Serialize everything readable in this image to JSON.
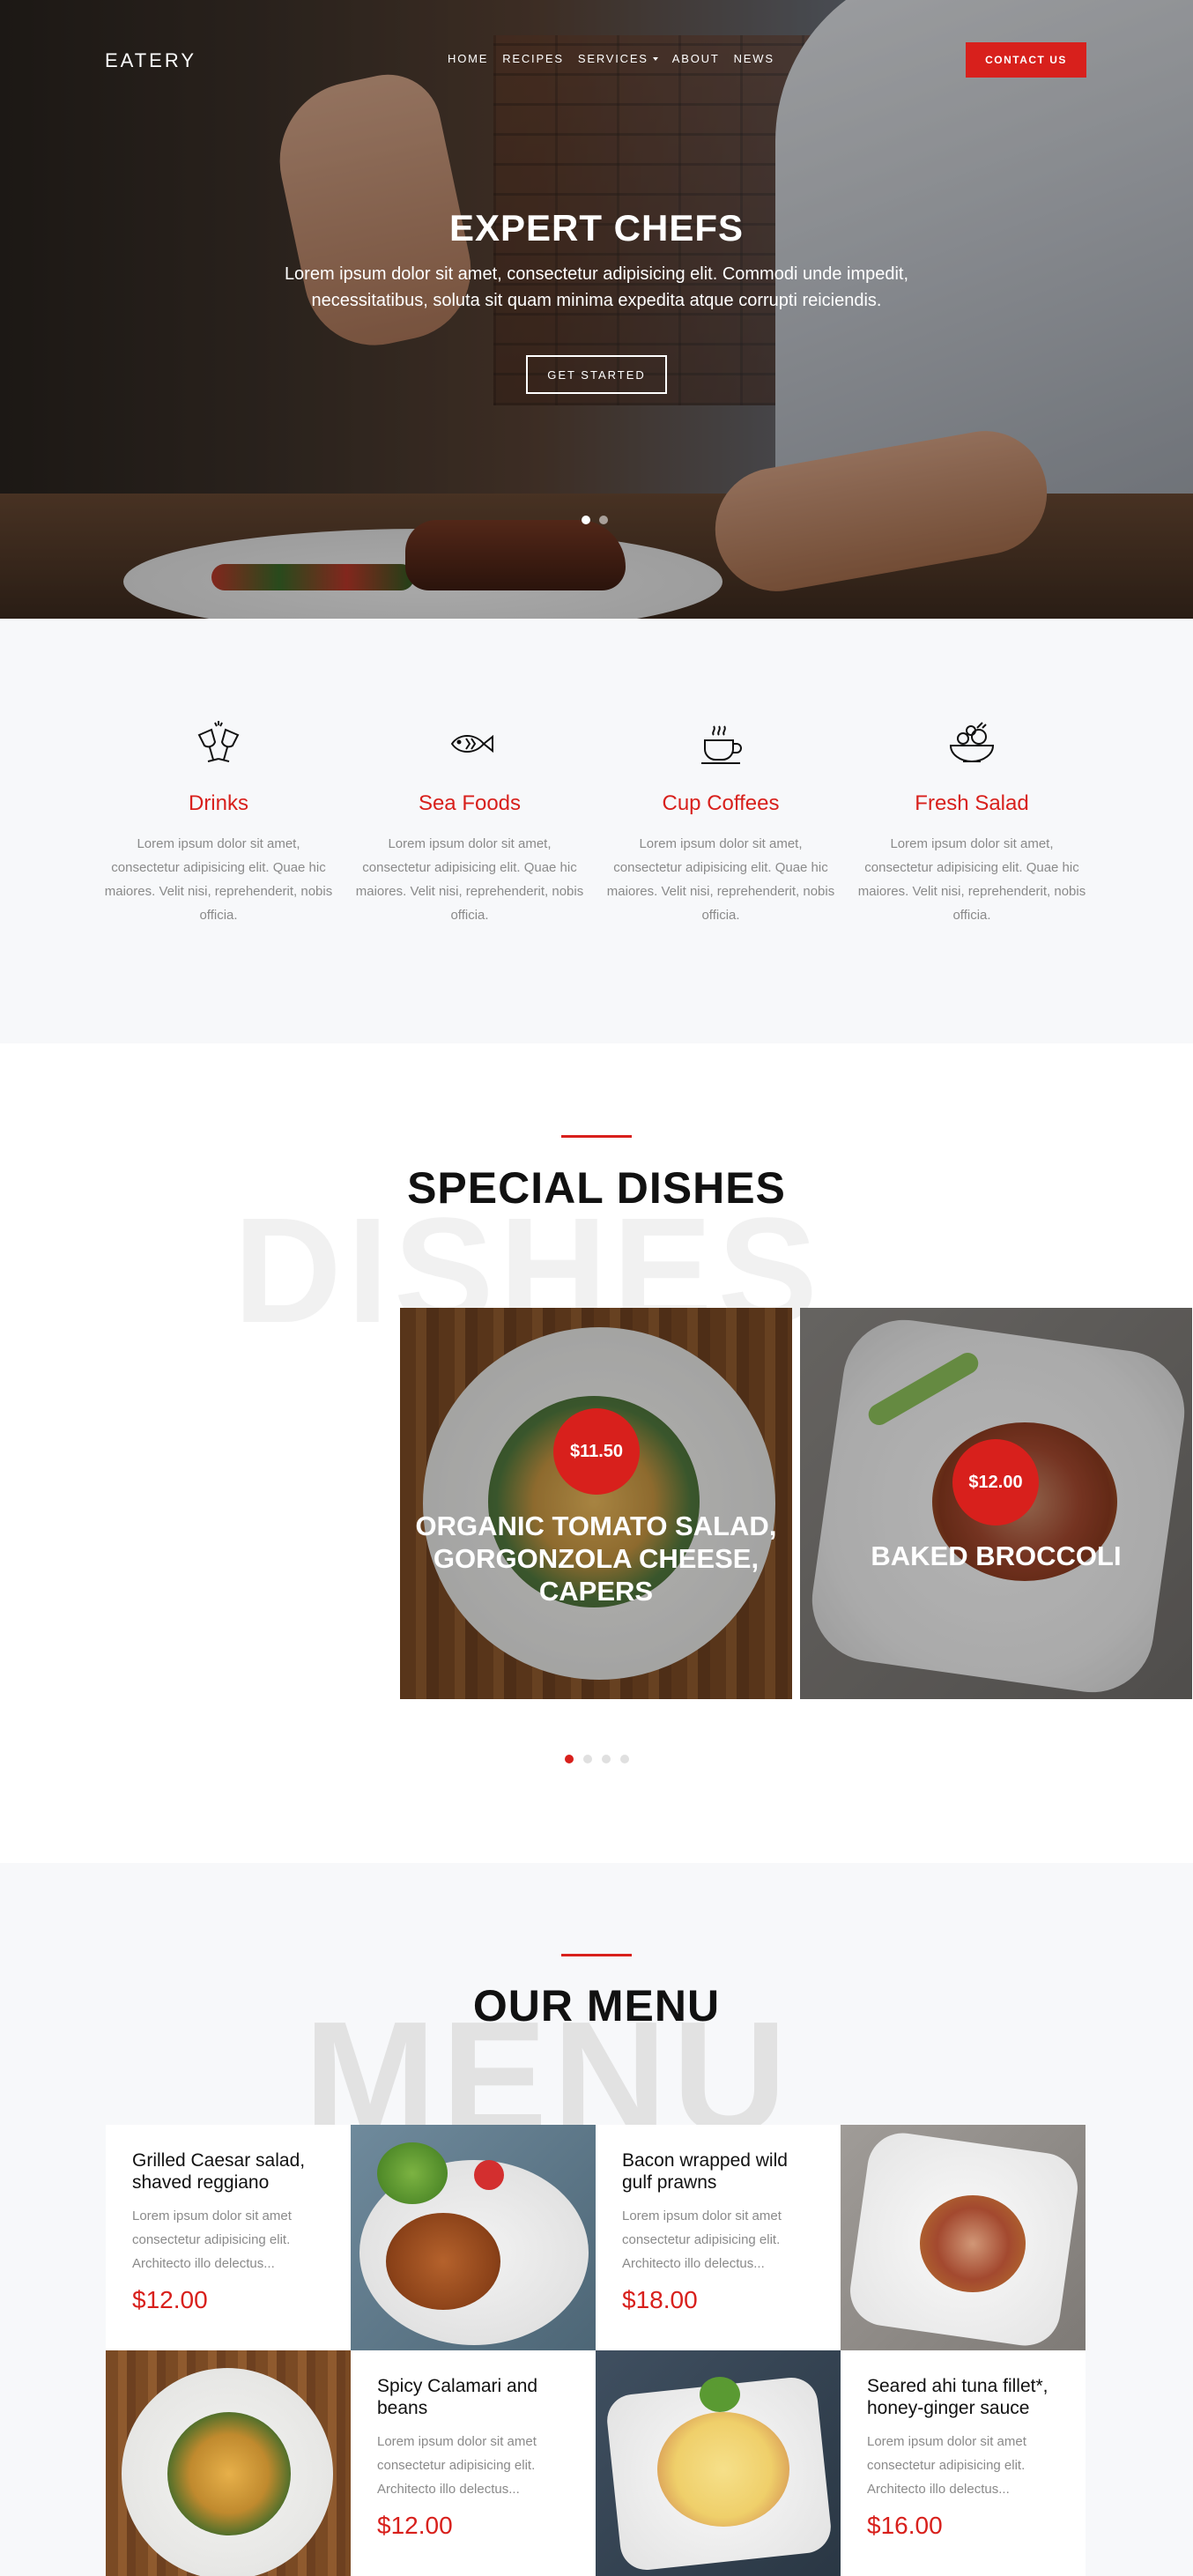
{
  "nav": {
    "brand": "EATERY",
    "items": [
      {
        "label": "HOME"
      },
      {
        "label": "RECIPES"
      },
      {
        "label": "SERVICES"
      },
      {
        "label": "ABOUT"
      },
      {
        "label": "NEWS"
      }
    ],
    "contact": "CONTACT US"
  },
  "hero": {
    "title": "EXPERT CHEFS",
    "subtitle": "Lorem ipsum dolor sit amet, consectetur adipisicing elit. Commodi unde impedit, necessitatibus, soluta sit quam minima expedita atque corrupti reiciendis.",
    "button": "GET STARTED",
    "slides": 2,
    "active_slide": 1
  },
  "features": [
    {
      "icon": "wine-glasses-icon",
      "title": "Drinks",
      "text": "Lorem ipsum dolor sit amet, consectetur adipisicing elit. Quae hic maiores. Velit nisi, reprehenderit, nobis officia."
    },
    {
      "icon": "fish-icon",
      "title": "Sea Foods",
      "text": "Lorem ipsum dolor sit amet, consectetur adipisicing elit. Quae hic maiores. Velit nisi, reprehenderit, nobis officia."
    },
    {
      "icon": "coffee-cup-icon",
      "title": "Cup Coffees",
      "text": "Lorem ipsum dolor sit amet, consectetur adipisicing elit. Quae hic maiores. Velit nisi, reprehenderit, nobis officia."
    },
    {
      "icon": "salad-bowl-icon",
      "title": "Fresh Salad",
      "text": "Lorem ipsum dolor sit amet, consectetur adipisicing elit. Quae hic maiores. Velit nisi, reprehenderit, nobis officia."
    }
  ],
  "special": {
    "title": "SPECIAL DISHES",
    "bg_word": "DISHES",
    "dishes": [
      {
        "price": "$11.50",
        "name": "ORGANIC TOMATO SALAD, GORGONZOLA CHEESE, CAPERS"
      },
      {
        "price": "$12.00",
        "name": "BAKED BROCCOLI"
      }
    ],
    "slides": 4,
    "active_slide": 1
  },
  "menu": {
    "title": "OUR MENU",
    "bg_word": "MENU",
    "items": [
      {
        "name": "Grilled Caesar salad, shaved reggiano",
        "desc": "Lorem ipsum dolor sit amet consectetur adipisicing elit. Architecto illo delectus...",
        "price": "$12.00"
      },
      {
        "name": "Bacon wrapped wild gulf prawns",
        "desc": "Lorem ipsum dolor sit amet consectetur adipisicing elit. Architecto illo delectus...",
        "price": "$18.00"
      },
      {
        "name": "Spicy Calamari and beans",
        "desc": "Lorem ipsum dolor sit amet consectetur adipisicing elit. Architecto illo delectus...",
        "price": "$12.00"
      },
      {
        "name": "Seared ahi tuna fillet*, honey-ginger sauce",
        "desc": "Lorem ipsum dolor sit amet consectetur adipisicing elit. Architecto illo delectus...",
        "price": "$16.00"
      }
    ]
  },
  "colors": {
    "accent": "#d8201c",
    "muted_text": "#8a8a8a",
    "section_bg": "#f7f8fa"
  }
}
